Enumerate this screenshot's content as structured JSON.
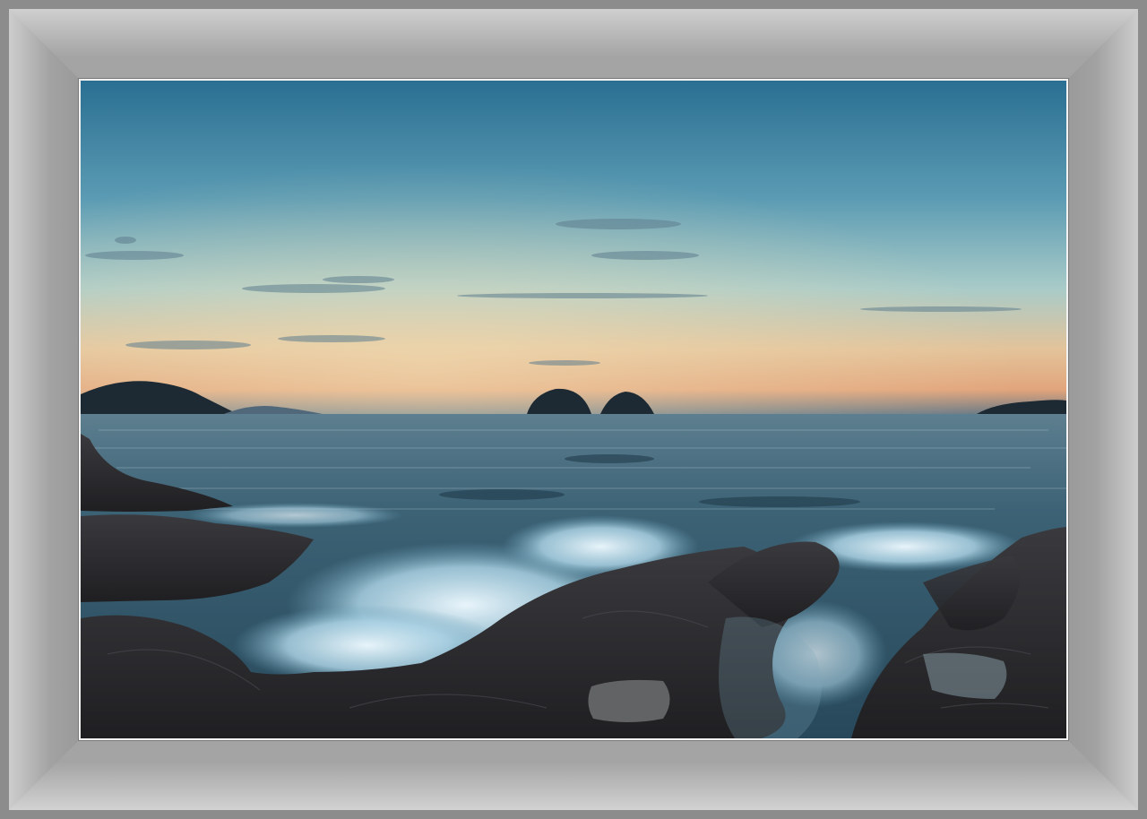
{
  "scene": {
    "subject": "seascape-at-dusk",
    "elements": [
      "sky",
      "clouds",
      "horizon-glow",
      "islands",
      "sea",
      "waves",
      "rocks",
      "tide-pools"
    ],
    "colors": {
      "frame": "#9a9a9a",
      "photo_border": "#f2f2f2",
      "sky_top": "#2a6f92",
      "sky_mid": "#7fb3c6",
      "horizon_glow": "#e9b083",
      "sea": "#2f5266",
      "foam": "#cfe6f0",
      "rock": "#2b2b2e"
    }
  }
}
